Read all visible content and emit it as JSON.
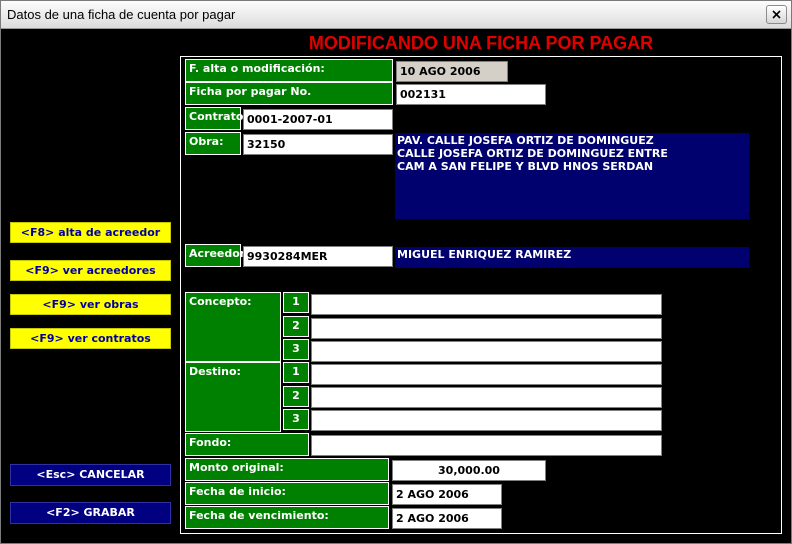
{
  "window": {
    "title": "Datos de una ficha de cuenta por pagar"
  },
  "header": {
    "title": "MODIFICANDO UNA FICHA POR PAGAR"
  },
  "colors": {
    "background": "#000000",
    "label_green": "#008000",
    "info_blue": "#00006e",
    "header_red": "#e00000",
    "action_yellow": "#ffff00",
    "button_navy": "#000080"
  },
  "side_buttons": [
    {
      "label": "<F8>  alta de acreedor"
    },
    {
      "label": "<F9>   ver acreedores"
    },
    {
      "label": "<F9>   ver obras"
    },
    {
      "label": "<F9>   ver contratos"
    }
  ],
  "bottom_buttons": {
    "cancel": "<Esc>  CANCELAR",
    "save": "<F2>   GRABAR"
  },
  "form": {
    "alta_label": "F. alta o modificación:",
    "alta_value": "10 AGO 2006",
    "ficha_label": "Ficha por pagar No.",
    "ficha_value": "002131",
    "contrato_label": "Contrato:",
    "contrato_value": "0001-2007-01",
    "obra_label": "Obra:",
    "obra_value": "32150",
    "obra_desc": "PAV. CALLE JOSEFA ORTIZ DE DOMINGUEZ\nCALLE JOSEFA ORTIZ DE DOMINGUEZ ENTRE\nCAM A SAN FELIPE Y BLVD HNOS SERDAN",
    "acreedor_label": "Acreedor:",
    "acreedor_value": "9930284MER",
    "acreedor_name": "MIGUEL ENRIQUEZ RAMIREZ",
    "concepto_label": "Concepto:",
    "concepto_lines": [
      {
        "num": "1",
        "value": ""
      },
      {
        "num": "2",
        "value": ""
      },
      {
        "num": "3",
        "value": ""
      }
    ],
    "destino_label": "Destino:",
    "destino_lines": [
      {
        "num": "1",
        "value": ""
      },
      {
        "num": "2",
        "value": ""
      },
      {
        "num": "3",
        "value": ""
      }
    ],
    "fondo_label": "Fondo:",
    "fondo_value": "",
    "monto_label": "Monto original:",
    "monto_value": "30,000.00",
    "inicio_label": "Fecha de inicio:",
    "inicio_value": "2 AGO 2006",
    "vencimiento_label": "Fecha de vencimiento:",
    "vencimiento_value": "2 AGO 2006"
  }
}
